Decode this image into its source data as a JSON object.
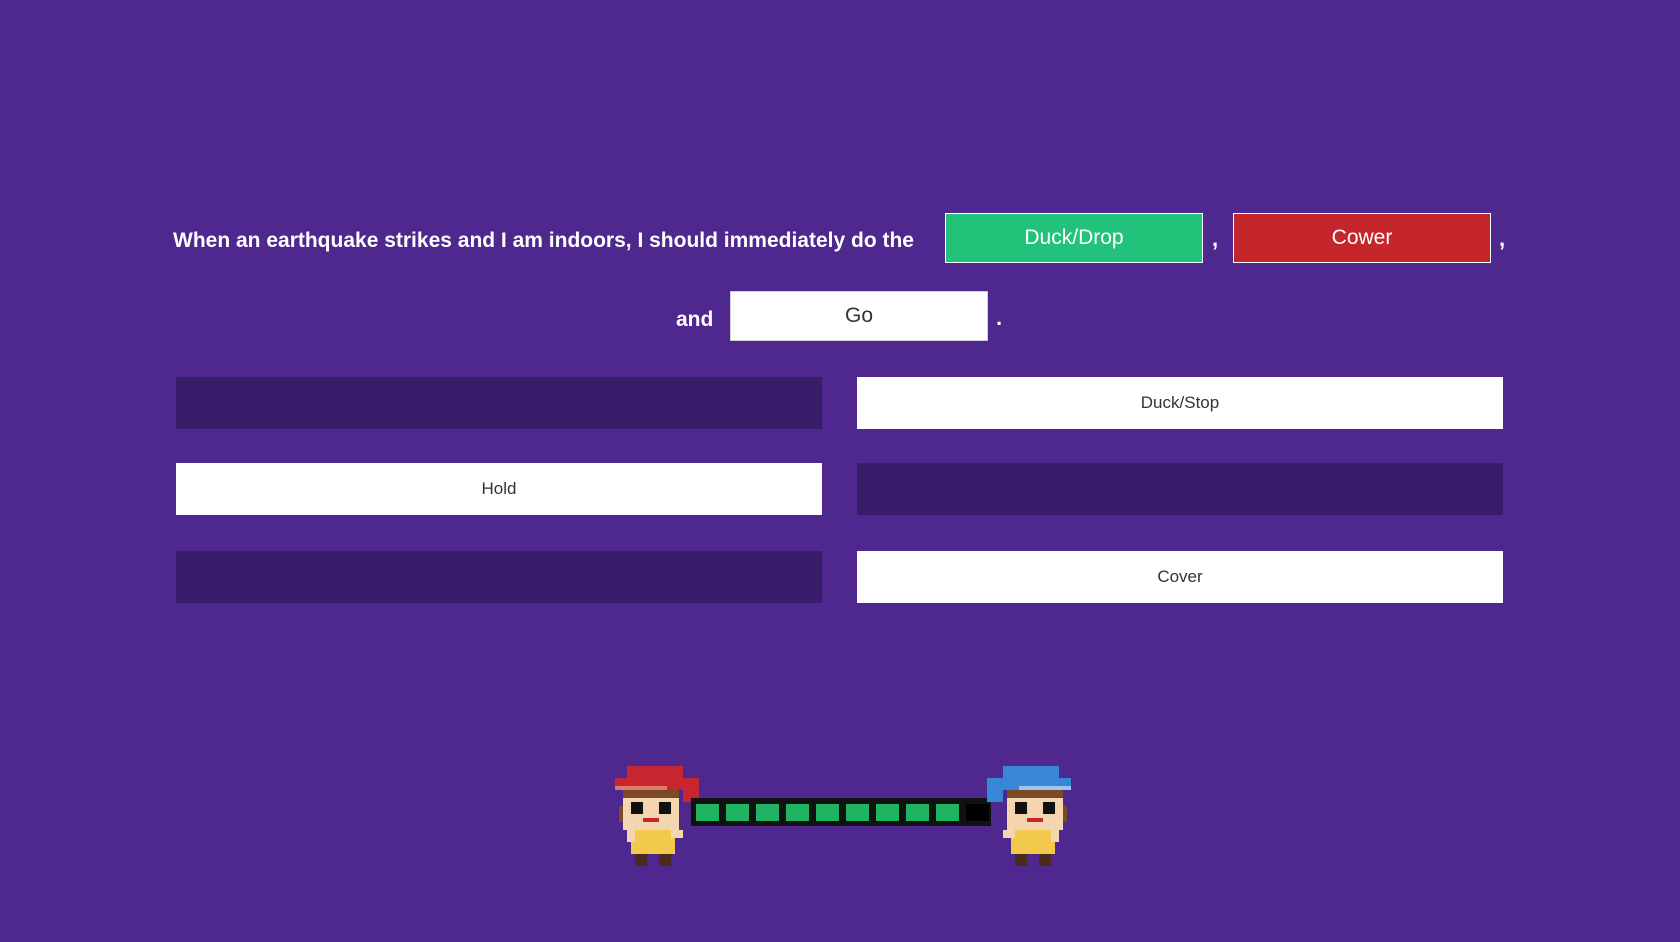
{
  "question": {
    "text_before": "When an earthquake strikes and I am indoors, I should immediately do the",
    "comma_1": ",",
    "comma_2": ",",
    "text_and": "and",
    "period": "."
  },
  "answer_slots": [
    {
      "label": "Duck/Drop",
      "state": "correct"
    },
    {
      "label": "Cower",
      "state": "wrong"
    },
    {
      "label": "Go",
      "state": "neutral"
    }
  ],
  "options": [
    {
      "label": "",
      "state": "used"
    },
    {
      "label": "Duck/Stop",
      "state": "available"
    },
    {
      "label": "Hold",
      "state": "available"
    },
    {
      "label": "",
      "state": "used"
    },
    {
      "label": "",
      "state": "used"
    },
    {
      "label": "Cover",
      "state": "available"
    }
  ],
  "progress": {
    "filled_segments": 9,
    "total_segments": 10
  },
  "colors": {
    "background": "#4e278f",
    "correct": "#22c27a",
    "wrong": "#c5262b",
    "empty_option": "#381d6a",
    "progress_fill": "#1fb463"
  },
  "characters": {
    "left": "player-red-hat",
    "right": "opponent-blue-hat"
  }
}
